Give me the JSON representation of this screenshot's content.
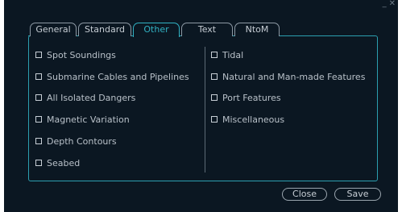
{
  "window": {
    "controls": [
      "_",
      "✕"
    ]
  },
  "tabs": [
    {
      "label": "General",
      "active": false
    },
    {
      "label": "Standard",
      "active": false
    },
    {
      "label": "Other",
      "active": true
    },
    {
      "label": "Text",
      "active": false
    },
    {
      "label": "NtoM",
      "active": false
    }
  ],
  "left_options": [
    {
      "label": "Spot Soundings",
      "checked": false
    },
    {
      "label": "Submarine Cables and Pipelines",
      "checked": false
    },
    {
      "label": "All Isolated Dangers",
      "checked": false
    },
    {
      "label": "Magnetic Variation",
      "checked": false
    },
    {
      "label": "Depth Contours",
      "checked": false
    },
    {
      "label": "Seabed",
      "checked": false
    }
  ],
  "right_options": [
    {
      "label": "Tidal",
      "checked": false
    },
    {
      "label": "Natural and Man-made Features",
      "checked": false
    },
    {
      "label": "Port Features",
      "checked": false
    },
    {
      "label": "Miscellaneous",
      "checked": false
    }
  ],
  "buttons": {
    "close": "Close",
    "save": "Save"
  },
  "colors": {
    "background": "#0b1722",
    "accent": "#31b1c2",
    "text": "#b8c0c8"
  }
}
